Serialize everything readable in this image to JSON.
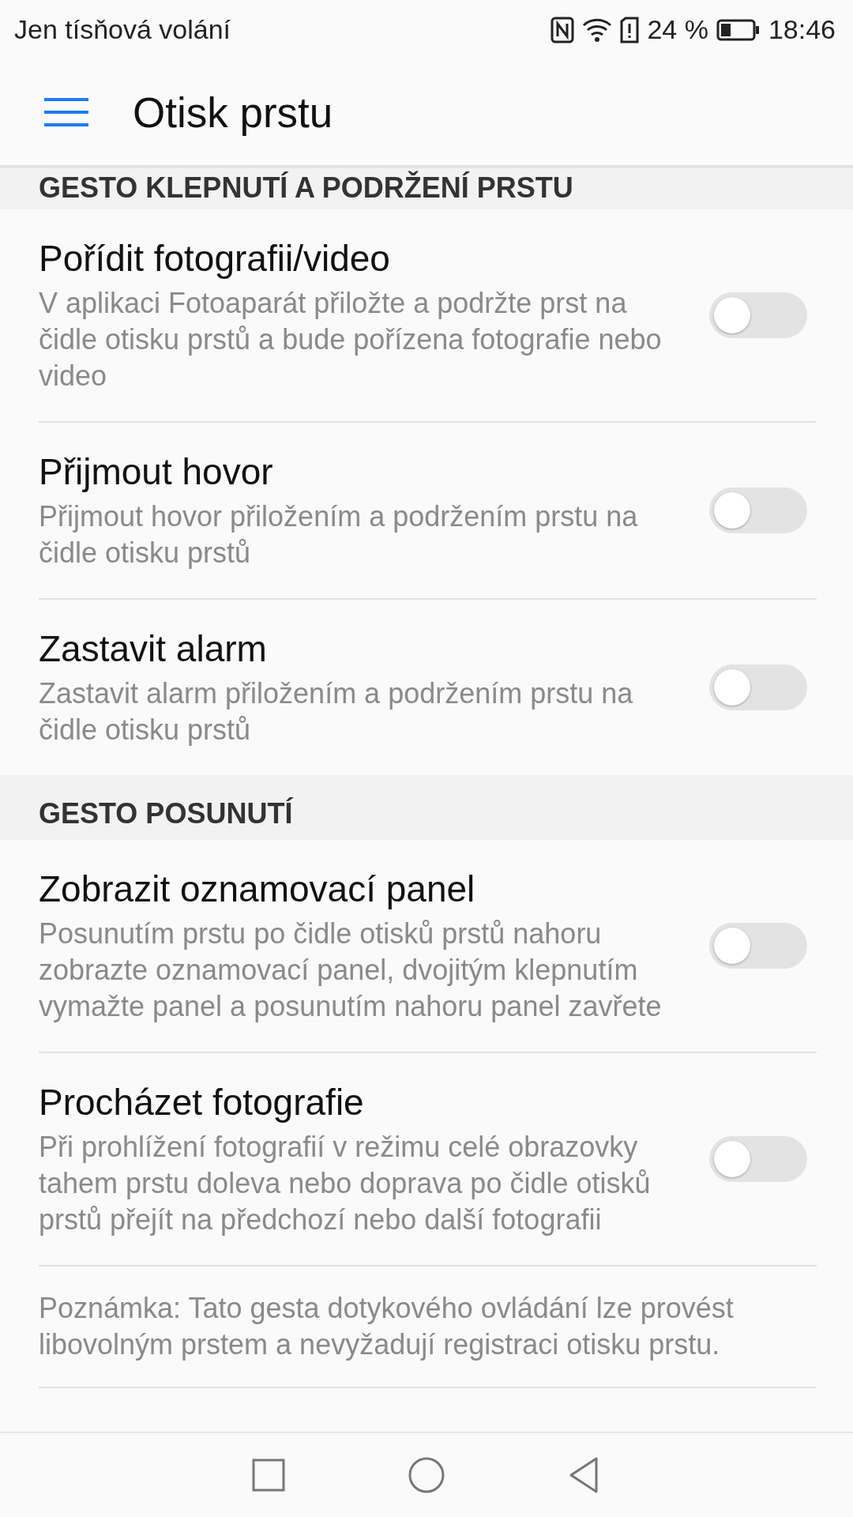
{
  "status_bar": {
    "carrier": "Jen tísňová volání",
    "battery": "24 %",
    "time": "18:46"
  },
  "app_bar": {
    "title": "Otisk prstu"
  },
  "sections": [
    {
      "header": "GESTO KLEPNUTÍ A PODRŽENÍ PRSTU",
      "clipped": true,
      "items": [
        {
          "title": "Pořídit fotografii/video",
          "description": "V aplikaci Fotoaparát přiložte a podržte prst na čidle otisku prstů a bude pořízena fotografie nebo video",
          "on": false
        },
        {
          "title": "Přijmout hovor",
          "description": "Přijmout hovor přiložením a podržením prstu na čidle otisku prstů",
          "on": false
        },
        {
          "title": "Zastavit alarm",
          "description": "Zastavit alarm přiložením a podržením prstu na čidle otisku prstů",
          "on": false
        }
      ]
    },
    {
      "header": "GESTO POSUNUTÍ",
      "clipped": false,
      "items": [
        {
          "title": "Zobrazit oznamovací panel",
          "description": "Posunutím prstu po čidle otisků prstů nahoru zobrazte oznamovací panel, dvojitým klepnutím vymažte panel a posunutím nahoru panel zavřete",
          "on": false
        },
        {
          "title": "Procházet fotografie",
          "description": "Při prohlížení fotografií v režimu celé obrazovky tahem prstu doleva nebo doprava po čidle otisků prstů přejít na předchozí nebo další fotografii",
          "on": false
        }
      ]
    }
  ],
  "note": "Poznámka: Tato gesta dotykového ovládání lze provést libovolným prstem a nevyžadují registraci otisku prstu."
}
